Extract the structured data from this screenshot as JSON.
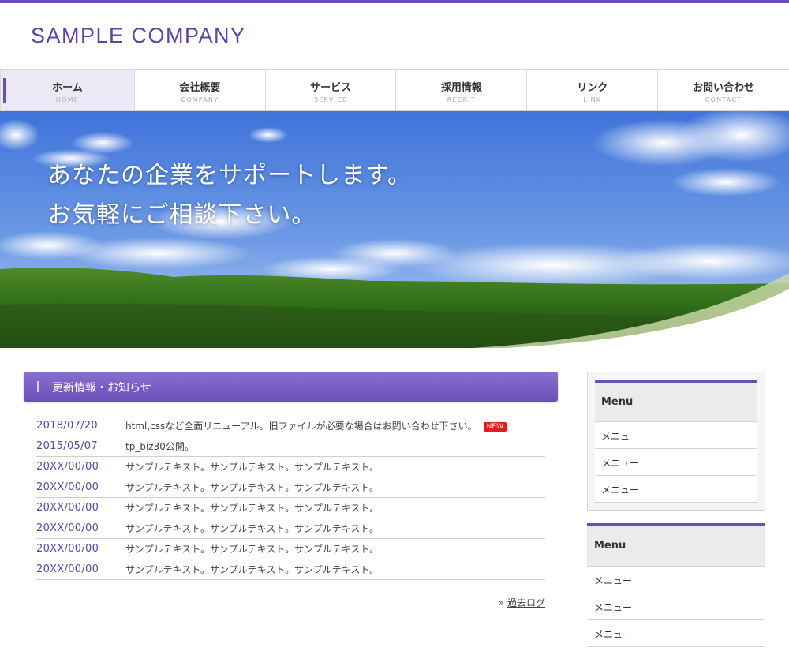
{
  "header": {
    "logo": "SAMPLE COMPANY"
  },
  "nav": [
    {
      "label": "ホーム",
      "sub": "HOME",
      "active": true
    },
    {
      "label": "会社概要",
      "sub": "COMPANY",
      "active": false
    },
    {
      "label": "サービス",
      "sub": "SERVICE",
      "active": false
    },
    {
      "label": "採用情報",
      "sub": "RECRIT",
      "active": false
    },
    {
      "label": "リンク",
      "sub": "LINK",
      "active": false
    },
    {
      "label": "お問い合わせ",
      "sub": "CONTACT",
      "active": false
    }
  ],
  "hero": {
    "line1": "あなたの企業をサポートします。",
    "line2": "お気軽にご相談下さい。"
  },
  "news": {
    "heading": "更新情報・お知らせ",
    "items": [
      {
        "date": "2018/07/20",
        "text": "html,cssなど全面リニューアル。旧ファイルが必要な場合はお問い合わせ下さい。",
        "badge": "NEW"
      },
      {
        "date": "2015/05/07",
        "text": "tp_biz30公開。"
      },
      {
        "date": "20XX/00/00",
        "text": "サンプルテキスト。サンプルテキスト。サンプルテキスト。"
      },
      {
        "date": "20XX/00/00",
        "text": "サンプルテキスト。サンプルテキスト。サンプルテキスト。"
      },
      {
        "date": "20XX/00/00",
        "text": "サンプルテキスト。サンプルテキスト。サンプルテキスト。"
      },
      {
        "date": "20XX/00/00",
        "text": "サンプルテキスト。サンプルテキスト。サンプルテキスト。"
      },
      {
        "date": "20XX/00/00",
        "text": "サンプルテキスト。サンプルテキスト。サンプルテキスト。"
      },
      {
        "date": "20XX/00/00",
        "text": "サンプルテキスト。サンプルテキスト。サンプルテキスト。"
      }
    ],
    "archive_prefix": "»",
    "archive_label": "過去ログ"
  },
  "sidebar": {
    "box1": {
      "title": "Menu",
      "items": [
        "メニュー",
        "メニュー",
        "メニュー"
      ]
    },
    "box2": {
      "title": "Menu",
      "items": [
        "メニュー",
        "メニュー",
        "メニュー"
      ]
    }
  },
  "colors": {
    "accent": "#6a4fbb",
    "badge": "#e0201a"
  }
}
